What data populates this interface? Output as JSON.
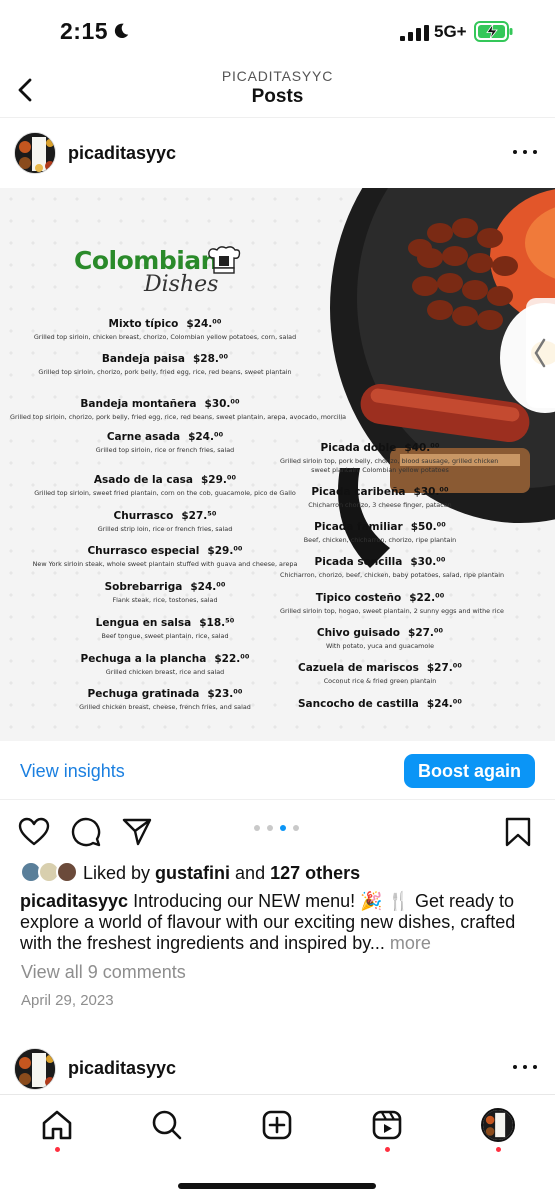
{
  "status_bar": {
    "time": "2:15",
    "network": "5G+",
    "moon_icon": "moon-icon",
    "signal_icon": "cellular-signal-icon",
    "battery_icon": "battery-charging-icon",
    "battery_color": "#34c759"
  },
  "header": {
    "subtitle": "PICADITASYYC",
    "title": "Posts",
    "back_icon": "chevron-left-icon"
  },
  "post": {
    "username": "picaditasyyc",
    "more_icon": "more-horizontal-icon",
    "image": {
      "brand_line1": "Colombian",
      "brand_line2": "Dishes",
      "brand_color": "#2a8a2a",
      "left_column": [
        {
          "name": "Mixto típico",
          "price": "$24.⁰⁰",
          "desc": "Grilled top sirloin, chicken breast, chorizo, Colombian yellow potatoes, corn, salad"
        },
        {
          "name": "Bandeja paisa",
          "price": "$28.⁰⁰",
          "desc": "Grilled top sirloin, chorizo, pork belly, fried egg, rice, red beans, sweet plantain"
        },
        {
          "name": "Bandeja montañera",
          "price": "$30.⁰⁰",
          "desc": "Grilled top sirloin, chorizo, pork belly, fried egg, rice, red beans, sweet plantain, arepa, avocado, morcilla"
        },
        {
          "name": "Carne asada",
          "price": "$24.⁰⁰",
          "desc": "Grilled top sirloin, rice or french fries, salad"
        },
        {
          "name": "Asado de la casa",
          "price": "$29.⁰⁰",
          "desc": "Grilled top sirloin, sweet fried plantain, corn on the cob, guacamole, pico de Gallo"
        },
        {
          "name": "Churrasco",
          "price": "$27.⁵⁰",
          "desc": "Grilled strip loin, rice or french fries, salad"
        },
        {
          "name": "Churrasco especial",
          "price": "$29.⁰⁰",
          "desc": "New York sirloin steak, whole sweet plantain stuffed with guava and cheese, arepa"
        },
        {
          "name": "Sobrebarriga",
          "price": "$24.⁰⁰",
          "desc": "Flank steak, rice, tostones, salad"
        },
        {
          "name": "Lengua en salsa",
          "price": "$18.⁵⁰",
          "desc": "Beef tongue, sweet plantain, rice, salad"
        },
        {
          "name": "Pechuga a la plancha",
          "price": "$22.⁰⁰",
          "desc": "Grilled chicken breast, rice and salad"
        },
        {
          "name": "Pechuga gratinada",
          "price": "$23.⁰⁰",
          "desc": "Grilled chicken breast, cheese, french fries, and salad"
        }
      ],
      "right_column": [
        {
          "name": "Picada doble",
          "price": "$40.⁰⁰",
          "desc": "Grilled sirloin top, pork belly, chorizo, blood sausage, grilled chicken",
          "desc2": "sweet plantain, Colombian yellow potatoes"
        },
        {
          "name": "Picada caribeña",
          "price": "$30.⁰⁰",
          "desc": "Chicharron chorizo, 3 cheese finger, patacon"
        },
        {
          "name": "Picada familiar",
          "price": "$50.⁰⁰",
          "desc": "Beef, chicken, chicharron, chorizo, ripe plantain"
        },
        {
          "name": "Picada sencilla",
          "price": "$30.⁰⁰",
          "desc": "Chicharron, chorizo, beef, chicken, baby potatoes, salad, ripe plantain"
        },
        {
          "name": "Tipico costeño",
          "price": "$22.⁰⁰",
          "desc": "Grilled sirloin top, hogao, sweet plantain, 2 sunny eggs and withe rice"
        },
        {
          "name": "Chivo guisado",
          "price": "$27.⁰⁰",
          "desc": "With potato, yuca and guacamole"
        },
        {
          "name": "Cazuela de mariscos",
          "price": "$27.⁰⁰",
          "desc": "Coconut rice & fried green plantain"
        },
        {
          "name": "Sancocho de castilla",
          "price": "$24.⁰⁰",
          "desc": ""
        }
      ]
    },
    "insights_label": "View insights",
    "boost_label": "Boost again",
    "accent_color": "#0b95f6",
    "action_icons": [
      "heart-icon",
      "comment-icon",
      "share-icon",
      "bookmark-icon"
    ],
    "pager": {
      "count": 4,
      "active": 3
    },
    "likes": {
      "prefix": "Liked by ",
      "user": "gustafini",
      "middle": " and ",
      "count": "127 others"
    },
    "caption": {
      "user": "picaditasyyc",
      "text": " Introducing our NEW menu! 🎉 🍴 Get ready to explore a world of flavour with our exciting new dishes, crafted with the freshest ingredients and inspired by...",
      "more": " more"
    },
    "comments_link": "View all 9 comments",
    "date": "April 29, 2023"
  },
  "next_post": {
    "username": "picaditasyyc"
  },
  "bottom_nav": {
    "items": [
      "home-icon",
      "search-icon",
      "create-icon",
      "reels-icon",
      "profile-avatar"
    ],
    "notification_color": "#ff3040"
  }
}
